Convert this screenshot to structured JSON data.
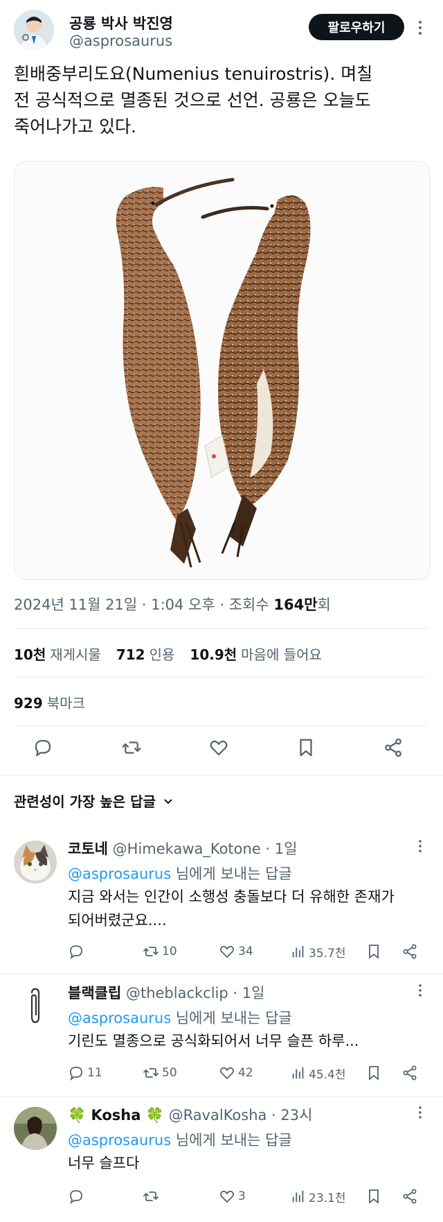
{
  "header": {
    "display_name": "공룡 박사 박진영",
    "handle": "@asprosaurus",
    "follow_label": "팔로우하기",
    "more_icon": "more-vertical-icon"
  },
  "tweet": {
    "text_line1": "흰배중부리도요(Numenius tenuirostris). 며칠",
    "text_line2": "전 공식적으로 멸종된 것으로 선언. 공룡은 오늘도",
    "text_line3": "죽어나가고 있다.",
    "image_subject": "two curlew specimens",
    "timestamp": "2024년 11월 21일 · 1:04 오후 · 조회수 ",
    "views": "164만",
    "views_suffix": "회"
  },
  "stats": {
    "retweets_count": "10천",
    "retweets_label": "재게시물",
    "quotes_count": "712",
    "quotes_label": "인용",
    "likes_count": "10.9천",
    "likes_label": "마음에 들어요",
    "bookmarks_count": "929",
    "bookmarks_label": "북마크"
  },
  "actions": {
    "icons": [
      "reply-icon",
      "retweet-icon",
      "like-icon",
      "bookmark-icon",
      "share-icon"
    ]
  },
  "replies_header": {
    "label": "관련성이 가장 높은 답글",
    "chevron": "chevron-down-icon"
  },
  "replies": [
    {
      "name": "코토네",
      "handle": "@Himekawa_Kotone · 1일",
      "reply_to": "@asprosaurus",
      "reply_to_suffix": " 님에게 보내는 답글",
      "line1": "지금 와서는 인간이 소행성 충돌보다 더 유해한 존재가",
      "line2": "되어버렸군요....",
      "replies": "",
      "retweets": "10",
      "likes": "34",
      "views": "35.7천"
    },
    {
      "name": "블랙클립",
      "handle": "@theblackclip · 1일",
      "reply_to": "@asprosaurus",
      "reply_to_suffix": " 님에게 보내는 답글",
      "line1": "기린도 멸종으로 공식화되어서 너무 슬픈 하루...",
      "line2": "",
      "replies": "11",
      "retweets": "50",
      "likes": "42",
      "views": "45.4천"
    },
    {
      "name": "🍀 Kosha 🍀",
      "handle": "@RavalKosha · 23시",
      "reply_to": "@asprosaurus",
      "reply_to_suffix": " 님에게 보내는 답글",
      "line1": "너무 슬프다",
      "line2": "",
      "replies": "",
      "retweets": "",
      "likes": "3",
      "views": "23.1천"
    }
  ],
  "colors": {
    "link": "#1d9bf0",
    "muted": "#536471",
    "text": "#0f1419",
    "divider": "#e6ecf0"
  }
}
